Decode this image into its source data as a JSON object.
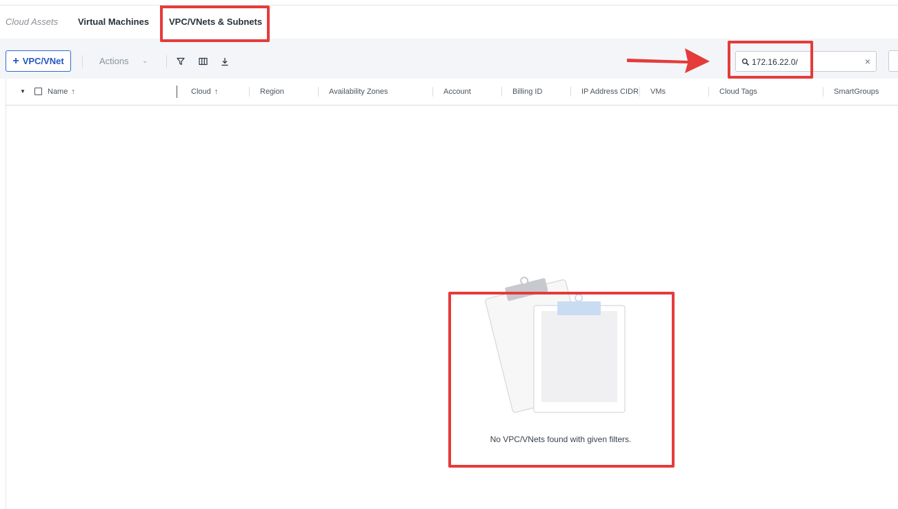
{
  "tabs": {
    "breadcrumb": "Cloud Assets",
    "items": [
      "Virtual Machines",
      "VPC/VNets & Subnets"
    ],
    "active": "VPC/VNets & Subnets"
  },
  "toolbar": {
    "add_label": "VPC/VNet",
    "actions_label": "Actions",
    "search_value": "172.16.22.0/"
  },
  "table": {
    "columns": [
      "Name",
      "Cloud",
      "Region",
      "Availability Zones",
      "Account",
      "Billing ID",
      "IP Address CIDR",
      "VMs",
      "Cloud Tags",
      "SmartGroups"
    ]
  },
  "empty_state": {
    "message": "No VPC/VNets found with given filters."
  },
  "colors": {
    "accent": "#2e6bd6",
    "annotation": "#e53b3b"
  }
}
